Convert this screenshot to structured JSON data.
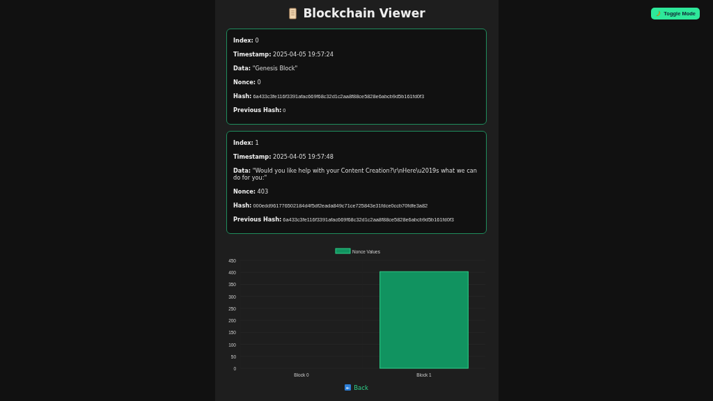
{
  "toggle_button": {
    "label": "Toggle Mode"
  },
  "title": "Blockchain Viewer",
  "blocks": [
    {
      "fields": [
        {
          "label": "Index:",
          "value": "0",
          "kind": "text"
        },
        {
          "label": "Timestamp:",
          "value": "2025-04-05 19:57:24",
          "kind": "text"
        },
        {
          "label": "Data:",
          "value": "\"Genesis Block\"",
          "kind": "text"
        },
        {
          "label": "Nonce:",
          "value": "0",
          "kind": "text"
        },
        {
          "label": "Hash:",
          "value": "6a433c3fe116f3391afac669f68c32d1c2aa8f88ce5828e6abcb9d5b161fd0f3",
          "kind": "hash"
        },
        {
          "label": "Previous Hash:",
          "value": "0",
          "kind": "hash"
        }
      ]
    },
    {
      "fields": [
        {
          "label": "Index:",
          "value": "1",
          "kind": "text"
        },
        {
          "label": "Timestamp:",
          "value": "2025-04-05 19:57:48",
          "kind": "text"
        },
        {
          "label": "Data:",
          "value": "\"Would you like help with your Content Creation?\\r\\nHere\\u2019s what we can do for you:\"",
          "kind": "text"
        },
        {
          "label": "Nonce:",
          "value": "403",
          "kind": "text"
        },
        {
          "label": "Hash:",
          "value": "000edd961776502184d4f5df2eada849c71ce725843e31fdce0ccb70fdfe3a82",
          "kind": "hash"
        },
        {
          "label": "Previous Hash:",
          "value": "6a433c3fe116f3391afac669f68c32d1c2aa8f88ce5828e6abcb9d5b161fd0f3",
          "kind": "hash"
        }
      ]
    }
  ],
  "chart": {
    "chart_data": {
      "type": "bar",
      "categories": [
        "Block 0",
        "Block 1"
      ],
      "series": [
        {
          "name": "Nonce Values",
          "color": "#119360",
          "values": [
            0,
            403
          ]
        }
      ],
      "ylim": [
        0,
        450
      ],
      "grid": true,
      "yticks": [
        0,
        50,
        100,
        150,
        200,
        250,
        300,
        350,
        400,
        450
      ]
    }
  },
  "back_link": {
    "label": "Back"
  }
}
